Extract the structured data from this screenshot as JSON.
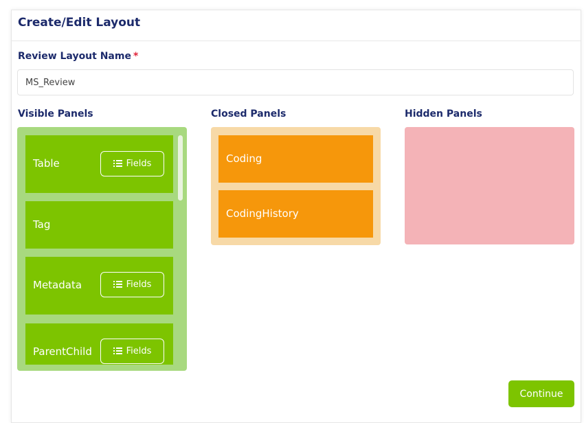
{
  "header": {
    "title": "Create/Edit Layout"
  },
  "form": {
    "name_label": "Review Layout Name",
    "required_mark": "*",
    "name_value": "MS_Review"
  },
  "columns": {
    "visible": "Visible Panels",
    "closed": "Closed Panels",
    "hidden": "Hidden Panels"
  },
  "visible_panels": [
    {
      "label": "Table",
      "fields_label": "Fields"
    },
    {
      "label": "Tag"
    },
    {
      "label": "Metadata",
      "fields_label": "Fields"
    },
    {
      "label": "ParentChild",
      "fields_label": "Fields"
    }
  ],
  "closed_panels": [
    {
      "label": "Coding"
    },
    {
      "label": "CodingHistory"
    }
  ],
  "hidden_panels": [],
  "actions": {
    "continue_label": "Continue"
  },
  "colors": {
    "visible_panel": "#7dc400",
    "visible_bg": "#a8d97f",
    "closed_panel": "#f6970b",
    "closed_bg": "#f7d9a7",
    "hidden_bg": "#f4b3b7",
    "title": "#1c2a6b"
  },
  "icons": {
    "fields": "list-icon"
  }
}
